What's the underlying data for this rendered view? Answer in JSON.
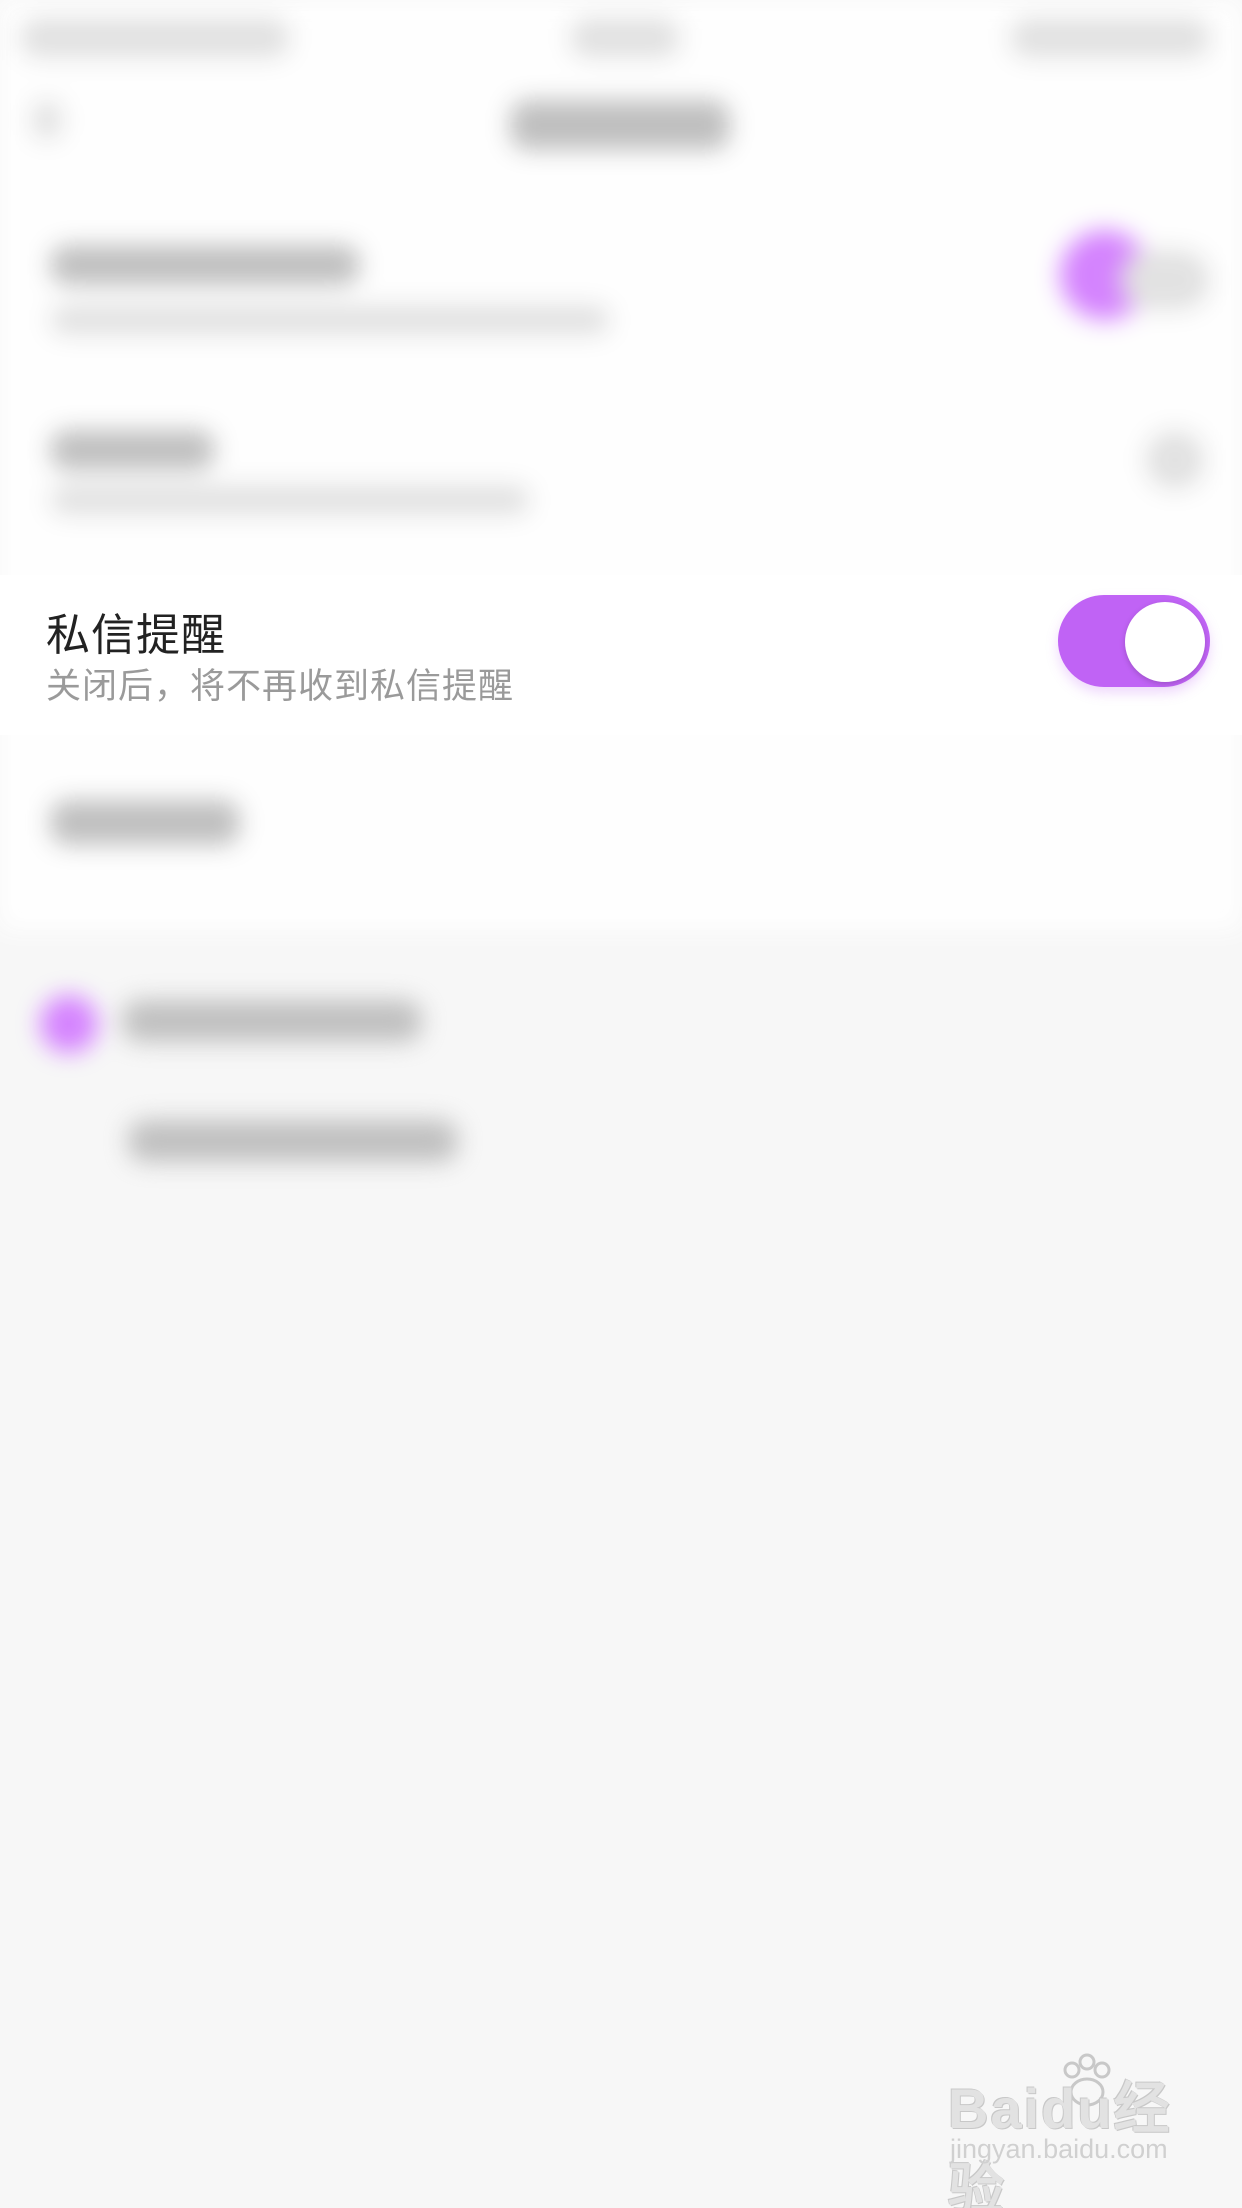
{
  "settings": {
    "private_message_reminder": {
      "title": "私信提醒",
      "subtitle": "关闭后，将不再收到私信提醒",
      "toggle_on": true
    }
  },
  "watermark": {
    "logo": "Baidu经验",
    "domain": "jingyan.baidu.com"
  },
  "colors": {
    "accent": "#c063f5",
    "page_bg": "#f7f7f7",
    "card_bg": "#ffffff"
  }
}
